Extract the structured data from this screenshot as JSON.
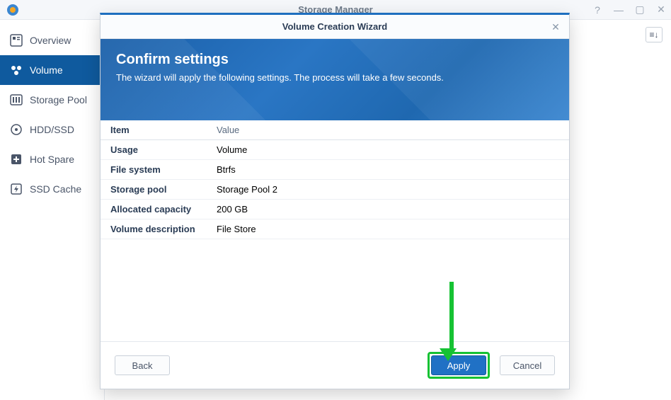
{
  "window": {
    "title": "Storage Manager"
  },
  "sidebar": {
    "items": [
      {
        "label": "Overview"
      },
      {
        "label": "Volume"
      },
      {
        "label": "Storage Pool"
      },
      {
        "label": "HDD/SSD"
      },
      {
        "label": "Hot Spare"
      },
      {
        "label": "SSD Cache"
      }
    ]
  },
  "modal": {
    "title": "Volume Creation Wizard",
    "banner": {
      "heading": "Confirm settings",
      "subtext": "The wizard will apply the following settings. The process will take a few seconds."
    },
    "table": {
      "headers": {
        "item": "Item",
        "value": "Value"
      },
      "rows": [
        {
          "item": "Usage",
          "value": "Volume"
        },
        {
          "item": "File system",
          "value": "Btrfs"
        },
        {
          "item": "Storage pool",
          "value": "Storage Pool 2"
        },
        {
          "item": "Allocated capacity",
          "value": "200 GB"
        },
        {
          "item": "Volume description",
          "value": "File Store"
        }
      ]
    },
    "buttons": {
      "back": "Back",
      "apply": "Apply",
      "cancel": "Cancel"
    }
  }
}
